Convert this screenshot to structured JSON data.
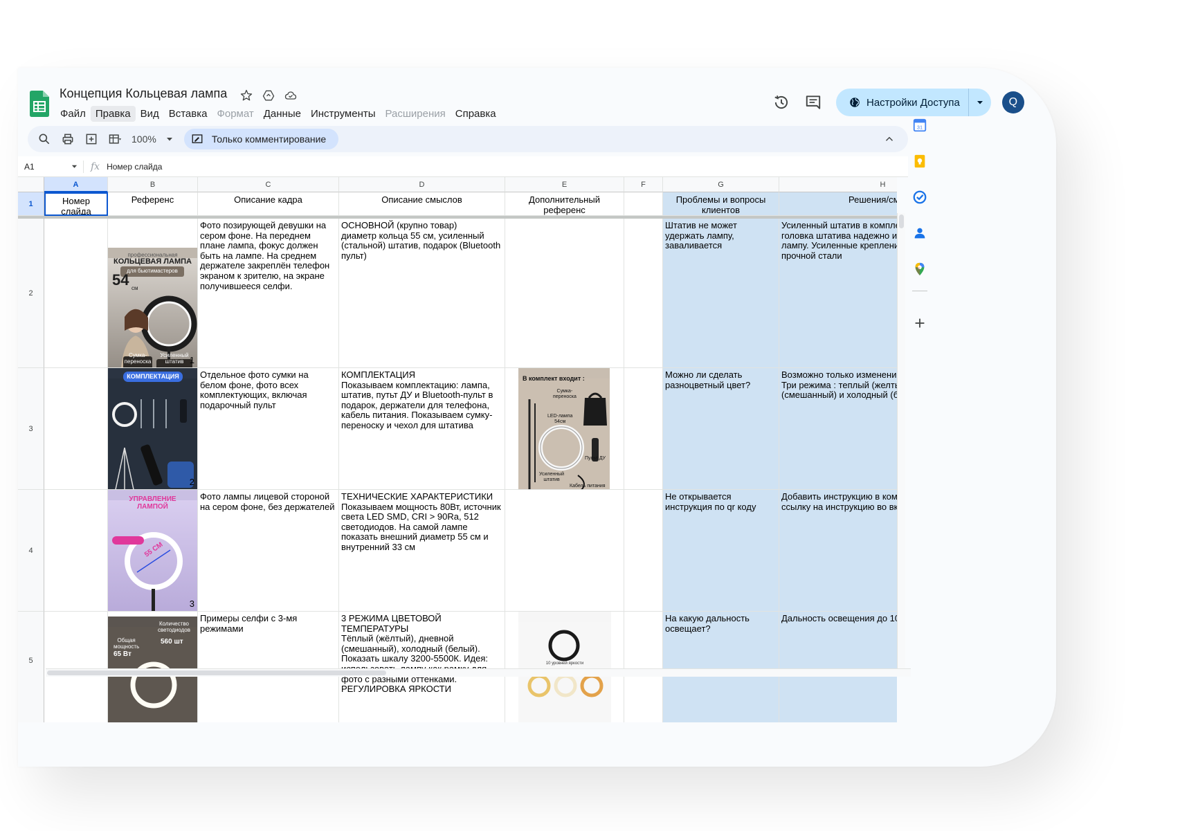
{
  "app": {
    "title": "Концепция Кольцевая лампа",
    "menu": [
      "Файл",
      "Правка",
      "Вид",
      "Вставка",
      "Формат",
      "Данные",
      "Инструменты",
      "Расширения",
      "Справка"
    ],
    "share_label": "Настройки Доступа",
    "avatar_letter": "Q"
  },
  "toolbar": {
    "zoom": "100%",
    "mode_label": "Только комментирование"
  },
  "formula_bar": {
    "cell_ref": "A1",
    "content": "Номер слайда"
  },
  "columns": [
    "A",
    "B",
    "C",
    "D",
    "E",
    "F",
    "G",
    "H"
  ],
  "rows": [
    "1",
    "2",
    "3",
    "4",
    "5"
  ],
  "header_row": {
    "a": "Номер слайда",
    "b": "Референс",
    "c": "Описание кадра",
    "d": "Описание смыслов",
    "e": "Дополнительный референс",
    "f": "",
    "g": "Проблемы и вопросы клиентов",
    "h": "Решения/см"
  },
  "data_rows": [
    {
      "num": "1",
      "c": "Фото позирующей девушки на сером фоне. На переднем плане лампа, фокус должен быть на лампе. На среднем держателе закреплён телефон экраном к зрителю, на экране получившееся селфи.",
      "d": "ОСНОВНОЙ (крупно товар)\nдиаметр кольца 55 см, усиленный (стальной) штатив, подарок (Bluetooth пульт)",
      "g": "Штатив не может удержать лампу, заваливается",
      "h": "Усиленный штатив в комплек\nголовка штатива надежно и у\nлампу.  Усиленные крепления\nпрочной стали"
    },
    {
      "num": "2",
      "c": "Отдельное фото сумки на белом фоне, фото всех комплектующих, включая подарочный пульт",
      "d": "КОМПЛЕКТАЦИЯ\nПоказываем комплектацию: лампа, штатив, путьт ДУ и Bluetooth-пульт в подарок, держатели для телефона, кабель питания. Показываем сумку-переноску и чехол для штатива",
      "g": "Можно ли сделать разноцветный цвет?",
      "h": "Возможно только изменение\nТри режима : теплый (желтый\n(смешанный) и холодный (бе"
    },
    {
      "num": "3",
      "c": "Фото лампы лицевой стороной на сером фоне, без держателей",
      "d": "ТЕХНИЧЕСКИЕ ХАРАКТЕРИСТИКИ\nПоказываем мощность 80Вт, источник света LED SMD, CRI > 90Ra, 512 светодиодов. На самой лампе показать внешний диаметр 55 см и внутренний 33 см",
      "g": "Не открывается инструкция по qr коду",
      "h": "Добавить инструкцию в компл\nссылку на инструкцию во вкл"
    },
    {
      "num": "",
      "c": "Примеры селфи с 3-мя режимами",
      "d": "3 РЕЖИМА ЦВЕТОВОЙ ТЕМПЕРАТУРЫ\nТёплый (жёлтый), дневной (смешанный), холодный (белый). Показать шкалу 3200-5500К. Идея: использовать лампу как рамку для фото с разными оттенками.\nРЕГУЛИРОВКА ЯРКОСТИ",
      "g": "На какую дальность освещает?",
      "h": "Дальность освещения до 10 м"
    }
  ],
  "thumbnails": {
    "t1_line1": "профессиональная",
    "t1_line2": "КОЛЬЦЕВАЯ ЛАМПА",
    "t1_line3": "для бьютимастеров",
    "t1_size": "54",
    "t1_unit": "см",
    "t1_tag1": "Сумка-\nпереноска",
    "t1_tag2": "Усиленный\nштатив",
    "t2_title": "КОМПЛЕКТАЦИЯ",
    "t3_title": "УПРАВЛЕНИЕ\nЛАМПОЙ",
    "t3_size": "55 СМ",
    "t4_label1": "Общая\nмощность",
    "t4_val1": "65 Вт",
    "t4_label2": "Количество\nсветодиодов",
    "t4_val2": "560 шт",
    "e3_title": "В комплект входит :",
    "e3_bag": "Сумка-\nпереноска",
    "e3_lamp": "LED-лампа\n54см",
    "e3_remote": "Пульт ДУ",
    "e3_stand": "Усиленный\nштатив",
    "e3_cable": "Кабель питания",
    "e5_label": "10 уровней яркости"
  }
}
